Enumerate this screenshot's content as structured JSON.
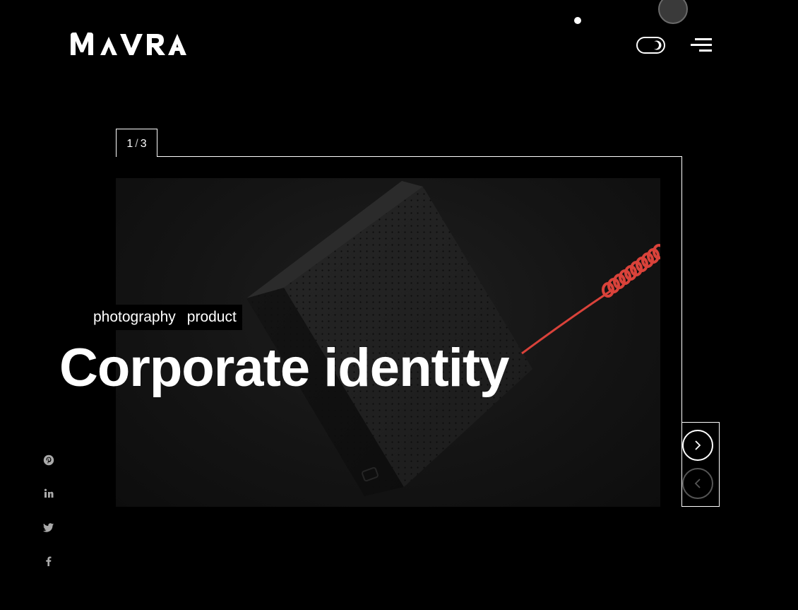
{
  "brand": {
    "logo_text": "MAVRA"
  },
  "header": {
    "theme_toggle_label": "",
    "menu_label": ""
  },
  "slider": {
    "counter": {
      "current": "1",
      "separator": "/",
      "total": "3"
    },
    "tags": [
      "photography",
      "product"
    ],
    "title": "Corporate identity"
  },
  "social": {
    "items": [
      {
        "name": "pinterest",
        "icon": "pinterest-icon"
      },
      {
        "name": "linkedin",
        "icon": "linkedin-icon"
      },
      {
        "name": "twitter",
        "icon": "twitter-icon"
      },
      {
        "name": "facebook",
        "icon": "facebook-icon"
      }
    ]
  },
  "colors": {
    "background": "#000000",
    "foreground": "#ffffff",
    "cable_accent": "#d9423a",
    "muted_icon": "#aaaaaa"
  }
}
